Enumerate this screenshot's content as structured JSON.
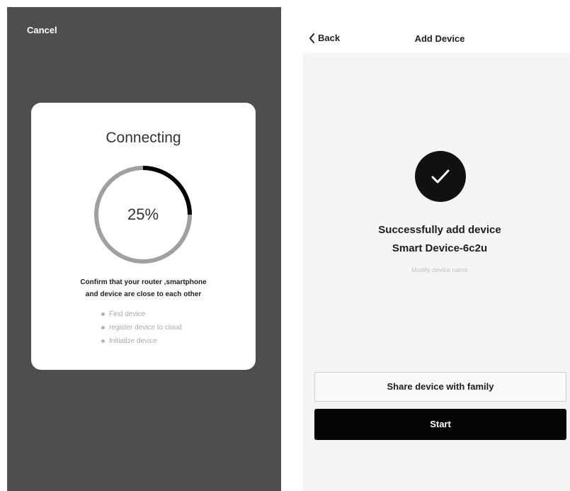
{
  "connecting_screen": {
    "cancel_label": "Cancel",
    "title": "Connecting",
    "progress_percent": 25,
    "progress_label": "25%",
    "instructions": [
      "Confirm that your router ,smartphone",
      "and device are close to each other"
    ],
    "steps": [
      "Find device",
      "register device to cloud",
      "Initialize device"
    ],
    "colors": {
      "background": "#4e4e4e",
      "progress_track": "#a0a0a0",
      "progress_fill": "#000000"
    }
  },
  "add_device_screen": {
    "back_label": "Back",
    "title": "Add Device",
    "success_icon": "checkmark-icon",
    "success_message": "Successfully add device",
    "device_name": "Smart Device-6c2u",
    "modify_label": "Modify device name",
    "share_button_label": "Share device with family",
    "start_button_label": "Start",
    "colors": {
      "background": "#f5f5f5",
      "start_button": "#050505"
    }
  }
}
